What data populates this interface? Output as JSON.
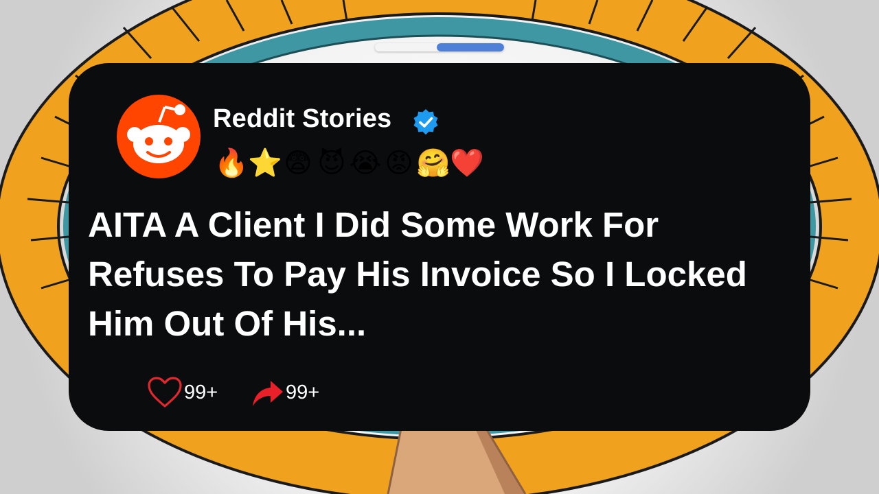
{
  "progress": {
    "fraction": 0.47
  },
  "post": {
    "channel_name": "Reddit Stories",
    "verified": true,
    "emojis": [
      "🔥",
      "⭐",
      "😨",
      "😈",
      "😭",
      "😡",
      "🤗",
      "❤️"
    ],
    "title": "AITA A Client I Did Some Work For Refuses To Pay His Invoice So I Locked Him Out Of His...",
    "likes": "99+",
    "shares": "99+"
  },
  "icons": {
    "avatar": "reddit-snoo-icon",
    "verified": "verified-badge-icon",
    "like": "heart-outline-icon",
    "share": "share-arrow-icon"
  },
  "colors": {
    "card": "#0b0c0e",
    "reddit_orange": "#ff4500",
    "verified_blue": "#1d9bf0",
    "like_red": "#e0282e",
    "share_red": "#e8202a",
    "progress_fill": "#4f80d8"
  }
}
